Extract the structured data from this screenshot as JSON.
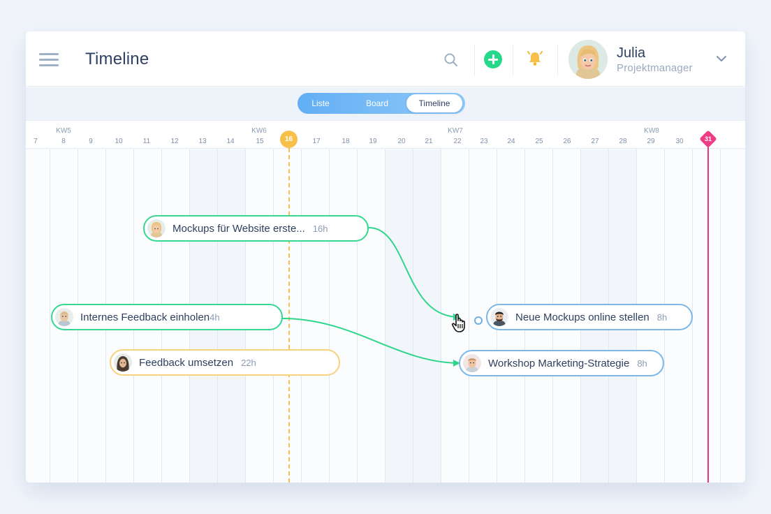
{
  "header": {
    "title": "Timeline",
    "user": {
      "name": "Julia",
      "role": "Projektmanager"
    }
  },
  "toolbar": {
    "views": [
      "Liste",
      "Board",
      "Timeline"
    ],
    "active_view": "Timeline"
  },
  "timeline": {
    "weeks": [
      "KW5",
      "KW6",
      "KW7",
      "KW8"
    ],
    "days": [
      "7",
      "8",
      "9",
      "10",
      "11",
      "12",
      "13",
      "14",
      "15",
      "16",
      "17",
      "18",
      "19",
      "20",
      "21",
      "22",
      "23",
      "24",
      "25",
      "26",
      "27",
      "28",
      "29",
      "30",
      "31"
    ],
    "today": "16",
    "deadline": "31",
    "tasks": [
      {
        "title": "Mockups für Website erste...",
        "hours": "16h",
        "color": "green"
      },
      {
        "title": "Internes Feedback einholen",
        "hours": "4h",
        "color": "green"
      },
      {
        "title": "Feedback umsetzen",
        "hours": "22h",
        "color": "yellow"
      },
      {
        "title": "Neue Mockups online stellen",
        "hours": "8h",
        "color": "blue"
      },
      {
        "title": "Workshop Marketing-Strategie",
        "hours": "8h",
        "color": "blue"
      }
    ]
  },
  "icons": {
    "menu": "hamburger-menu-icon",
    "search": "search-icon",
    "add": "plus-circle-icon",
    "notifications": "bell-icon",
    "expand": "chevron-down-icon",
    "cursor": "hand-cursor-icon"
  },
  "colors": {
    "green": "#35d892",
    "blue": "#7cb7e8",
    "yellow": "#f6d27c",
    "today": "#f7c04b",
    "deadline": "#e8357d",
    "switch_gradient_start": "#62aef5"
  }
}
